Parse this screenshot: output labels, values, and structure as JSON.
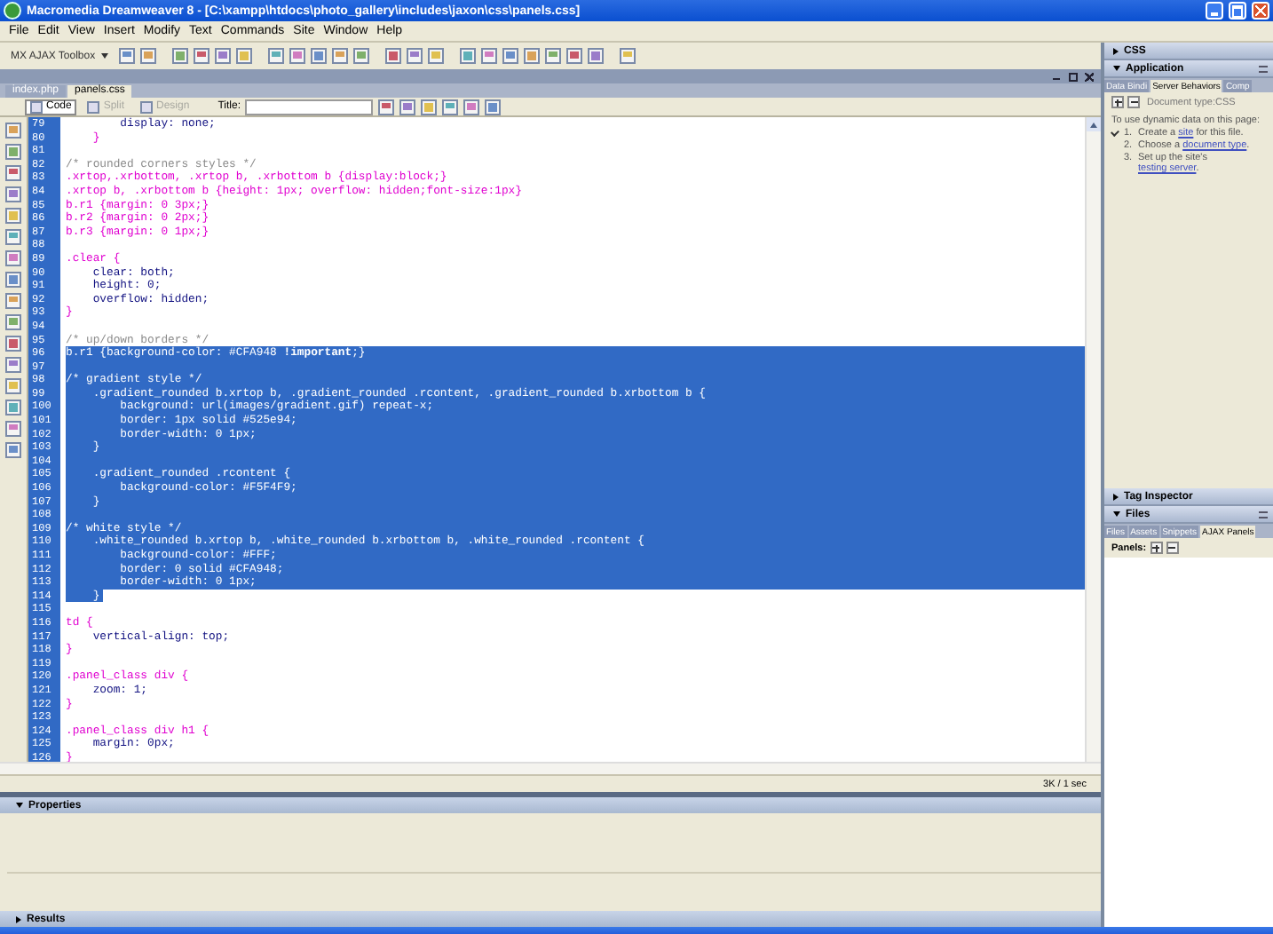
{
  "window": {
    "title": "Macromedia Dreamweaver 8 - [C:\\xampp\\htdocs\\photo_gallery\\includes\\jaxon\\css\\panels.css]"
  },
  "menu": [
    "File",
    "Edit",
    "View",
    "Insert",
    "Modify",
    "Text",
    "Commands",
    "Site",
    "Window",
    "Help"
  ],
  "insert_bar": {
    "category": "MX AJAX Toolbox"
  },
  "document": {
    "tabs": [
      {
        "label": "index.php",
        "selected": false
      },
      {
        "label": "panels.css",
        "selected": true
      }
    ],
    "view_buttons": [
      {
        "label": "Code",
        "selected": true,
        "disabled": false
      },
      {
        "label": "Split",
        "selected": false,
        "disabled": true
      },
      {
        "label": "Design",
        "selected": false,
        "disabled": true
      }
    ],
    "title_label": "Title:",
    "code_lines": [
      {
        "number": "79",
        "kind": "prop",
        "text": "        display: none;",
        "selected": false
      },
      {
        "number": "80",
        "kind": "selector",
        "text": "    }",
        "selected": false
      },
      {
        "number": "81",
        "kind": "blank",
        "selected": false
      },
      {
        "number": "82",
        "kind": "comment",
        "text": "/* rounded corners styles */",
        "selected": false
      },
      {
        "number": "83",
        "kind": "selector",
        "text": ".xrtop,.xrbottom, .xrtop b, .xrbottom b {display:block;}",
        "selected": false
      },
      {
        "number": "84",
        "kind": "selector",
        "text": ".xrtop b, .xrbottom b {height: 1px; overflow: hidden;font-size:1px}",
        "selected": false
      },
      {
        "number": "85",
        "kind": "selector",
        "text": "b.r1 {margin: 0 3px;}",
        "selected": false
      },
      {
        "number": "86",
        "kind": "selector",
        "text": "b.r2 {margin: 0 2px;}",
        "selected": false
      },
      {
        "number": "87",
        "kind": "selector",
        "text": "b.r3 {margin: 0 1px;}",
        "selected": false
      },
      {
        "number": "88",
        "kind": "blank",
        "selected": false
      },
      {
        "number": "89",
        "kind": "selector",
        "text": ".clear {",
        "selected": false
      },
      {
        "number": "90",
        "kind": "prop",
        "text": "    clear: both;",
        "selected": false
      },
      {
        "number": "91",
        "kind": "prop",
        "text": "    height: 0;",
        "selected": false
      },
      {
        "number": "92",
        "kind": "prop",
        "text": "    overflow: hidden;",
        "selected": false
      },
      {
        "number": "93",
        "kind": "selector",
        "text": "}",
        "selected": false
      },
      {
        "number": "94",
        "kind": "blank",
        "selected": false
      },
      {
        "number": "95",
        "kind": "comment",
        "text": "/* up/down borders */",
        "selected": false
      },
      {
        "number": "96",
        "kind": "selector",
        "text": "b.r1 {background-color: #CFA948 **!important**;}",
        "selected": true
      },
      {
        "number": "97",
        "kind": "blank",
        "selected": true
      },
      {
        "number": "98",
        "kind": "comment",
        "text": "/* gradient style */",
        "selected": true
      },
      {
        "number": "99",
        "kind": "selector",
        "text": "    .gradient_rounded b.xrtop b, .gradient_rounded .rcontent, .gradient_rounded b.xrbottom b {",
        "selected": true
      },
      {
        "number": "100",
        "kind": "prop",
        "text": "        background: url(images/gradient.gif) repeat-x;",
        "selected": true
      },
      {
        "number": "101",
        "kind": "prop",
        "text": "        border: 1px solid #525e94;",
        "selected": true
      },
      {
        "number": "102",
        "kind": "prop",
        "text": "        border-width: 0 1px;",
        "selected": true
      },
      {
        "number": "103",
        "kind": "selector",
        "text": "    }",
        "selected": true
      },
      {
        "number": "104",
        "kind": "blank",
        "selected": true
      },
      {
        "number": "105",
        "kind": "selector",
        "text": "    .gradient_rounded .rcontent {",
        "selected": true
      },
      {
        "number": "106",
        "kind": "prop",
        "text": "        background-color: #F5F4F9;",
        "selected": true
      },
      {
        "number": "107",
        "kind": "selector",
        "text": "    }",
        "selected": true
      },
      {
        "number": "108",
        "kind": "blank",
        "selected": true
      },
      {
        "number": "109",
        "kind": "comment",
        "text": "/* white style */",
        "selected": true
      },
      {
        "number": "110",
        "kind": "selector",
        "text": "    .white_rounded b.xrtop b, .white_rounded b.xrbottom b, .white_rounded .rcontent {",
        "selected": true
      },
      {
        "number": "111",
        "kind": "prop",
        "text": "        background-color: #FFF;",
        "selected": true
      },
      {
        "number": "112",
        "kind": "prop",
        "text": "        border: 0 solid #CFA948;",
        "selected": true
      },
      {
        "number": "113",
        "kind": "prop",
        "text": "        border-width: 0 1px;",
        "selected": true
      },
      {
        "number": "114",
        "kind": "selector",
        "text": "    }",
        "selected": true
      },
      {
        "number": "115",
        "kind": "blank",
        "selected": false
      },
      {
        "number": "116",
        "kind": "selector",
        "text": "td {",
        "selected": false
      },
      {
        "number": "117",
        "kind": "prop",
        "text": "    vertical-align: top;",
        "selected": false
      },
      {
        "number": "118",
        "kind": "selector",
        "text": "}",
        "selected": false
      },
      {
        "number": "119",
        "kind": "blank",
        "selected": false
      },
      {
        "number": "120",
        "kind": "selector",
        "text": ".panel_class div {",
        "selected": false
      },
      {
        "number": "121",
        "kind": "prop",
        "text": "    zoom: 1;",
        "selected": false
      },
      {
        "number": "122",
        "kind": "selector",
        "text": "}",
        "selected": false
      },
      {
        "number": "123",
        "kind": "blank",
        "selected": false
      },
      {
        "number": "124",
        "kind": "selector",
        "text": ".panel_class div h1 {",
        "selected": false
      },
      {
        "number": "125",
        "kind": "prop",
        "text": "    margin: 0px;",
        "selected": false
      },
      {
        "number": "126",
        "kind": "selector",
        "text": "}",
        "selected": false
      }
    ],
    "status": "3K / 1 sec"
  },
  "panels": {
    "css": {
      "title": "CSS",
      "expanded": false
    },
    "application": {
      "title": "Application",
      "expanded": true,
      "tabs": [
        {
          "label": "Data Bindi",
          "selected": false
        },
        {
          "label": "Server Behaviors",
          "selected": true
        },
        {
          "label": "Comp",
          "selected": false
        }
      ],
      "document_type": "Document type:CSS",
      "intro": "To use dynamic data on this page:",
      "steps": [
        {
          "number": "1.",
          "before": "Create a ",
          "link": "site",
          "after": " for this file.",
          "done": true
        },
        {
          "number": "2.",
          "before": "Choose a ",
          "link": "document type",
          "after": ".",
          "done": false
        },
        {
          "number": "3.",
          "before": "Set up the site's ",
          "link": "testing server",
          "after": ".",
          "done": false
        }
      ]
    },
    "tag_inspector": {
      "title": "Tag Inspector",
      "expanded": false
    },
    "files": {
      "title": "Files",
      "expanded": true,
      "tabs": [
        {
          "label": "Files",
          "selected": false
        },
        {
          "label": "Assets",
          "selected": false
        },
        {
          "label": "Snippets",
          "selected": false
        },
        {
          "label": "AJAX Panels",
          "selected": true
        }
      ],
      "panels_label": "Panels:"
    }
  },
  "properties": {
    "title": "Properties",
    "expanded": true
  },
  "results": {
    "title": "Results",
    "expanded": false
  }
}
